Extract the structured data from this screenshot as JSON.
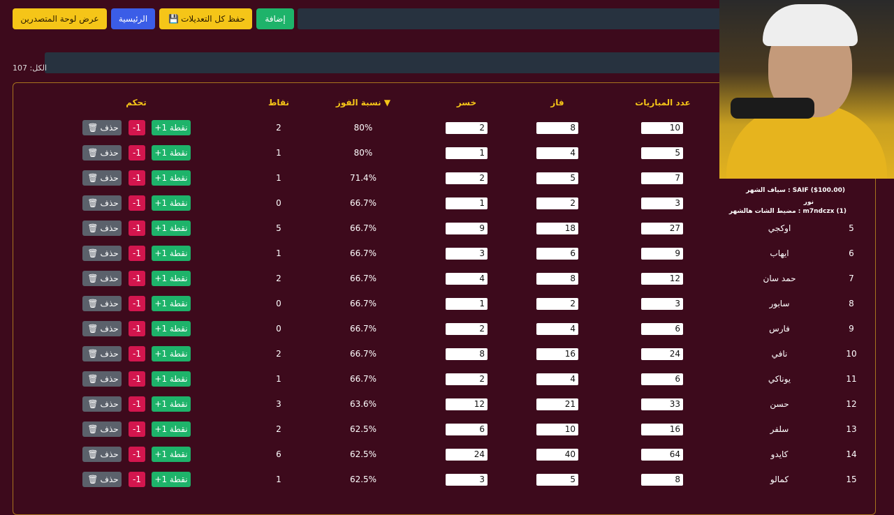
{
  "toolbar": {
    "leaderboard_label": "عرض لوحة المتصدرين",
    "home_label": "الرئيسية",
    "save_all_label": "حفظ كل التعديلات",
    "add_label": "إضافة"
  },
  "total_label": "الكل: 107",
  "table": {
    "headers": {
      "matches": "عدد المباريات",
      "won": "فاز",
      "lost": "خسر",
      "win_rate": "نسبة الفوز ▼",
      "points": "نقاط",
      "controls": "تحكم"
    },
    "actions": {
      "plus": "+1 نقطة",
      "minus": "-1",
      "delete": "حذف"
    },
    "rows": [
      {
        "rank": "",
        "name": "",
        "matches": "10",
        "won": "8",
        "lost": "2",
        "rate": "80%",
        "points": "2"
      },
      {
        "rank": "",
        "name": "",
        "matches": "5",
        "won": "4",
        "lost": "1",
        "rate": "80%",
        "points": "1"
      },
      {
        "rank": "",
        "name": "",
        "matches": "7",
        "won": "5",
        "lost": "2",
        "rate": "71.4%",
        "points": "1"
      },
      {
        "rank": "",
        "name": "",
        "matches": "3",
        "won": "2",
        "lost": "1",
        "rate": "66.7%",
        "points": "0"
      },
      {
        "rank": "5",
        "name": "اوكجي",
        "matches": "27",
        "won": "18",
        "lost": "9",
        "rate": "66.7%",
        "points": "5"
      },
      {
        "rank": "6",
        "name": "ايهاب",
        "matches": "9",
        "won": "6",
        "lost": "3",
        "rate": "66.7%",
        "points": "1"
      },
      {
        "rank": "7",
        "name": "حمد سان",
        "matches": "12",
        "won": "8",
        "lost": "4",
        "rate": "66.7%",
        "points": "2"
      },
      {
        "rank": "8",
        "name": "سابور",
        "matches": "3",
        "won": "2",
        "lost": "1",
        "rate": "66.7%",
        "points": "0"
      },
      {
        "rank": "9",
        "name": "فارس",
        "matches": "6",
        "won": "4",
        "lost": "2",
        "rate": "66.7%",
        "points": "0"
      },
      {
        "rank": "10",
        "name": "نافي",
        "matches": "24",
        "won": "16",
        "lost": "8",
        "rate": "66.7%",
        "points": "2"
      },
      {
        "rank": "11",
        "name": "يوناكي",
        "matches": "6",
        "won": "4",
        "lost": "2",
        "rate": "66.7%",
        "points": "1"
      },
      {
        "rank": "12",
        "name": "حسن",
        "matches": "33",
        "won": "21",
        "lost": "12",
        "rate": "63.6%",
        "points": "3"
      },
      {
        "rank": "13",
        "name": "سلفر",
        "matches": "16",
        "won": "10",
        "lost": "6",
        "rate": "62.5%",
        "points": "2"
      },
      {
        "rank": "14",
        "name": "كايدو",
        "matches": "64",
        "won": "40",
        "lost": "24",
        "rate": "62.5%",
        "points": "6"
      },
      {
        "rank": "15",
        "name": "كمالو",
        "matches": "8",
        "won": "5",
        "lost": "3",
        "rate": "62.5%",
        "points": "1"
      }
    ]
  },
  "stream_overlay": {
    "line1": "سياف الشهر : SAIF ($100.00)",
    "line2": "نور",
    "line3": "مضيط الشات هالشهر : m7ndczx (1)"
  }
}
